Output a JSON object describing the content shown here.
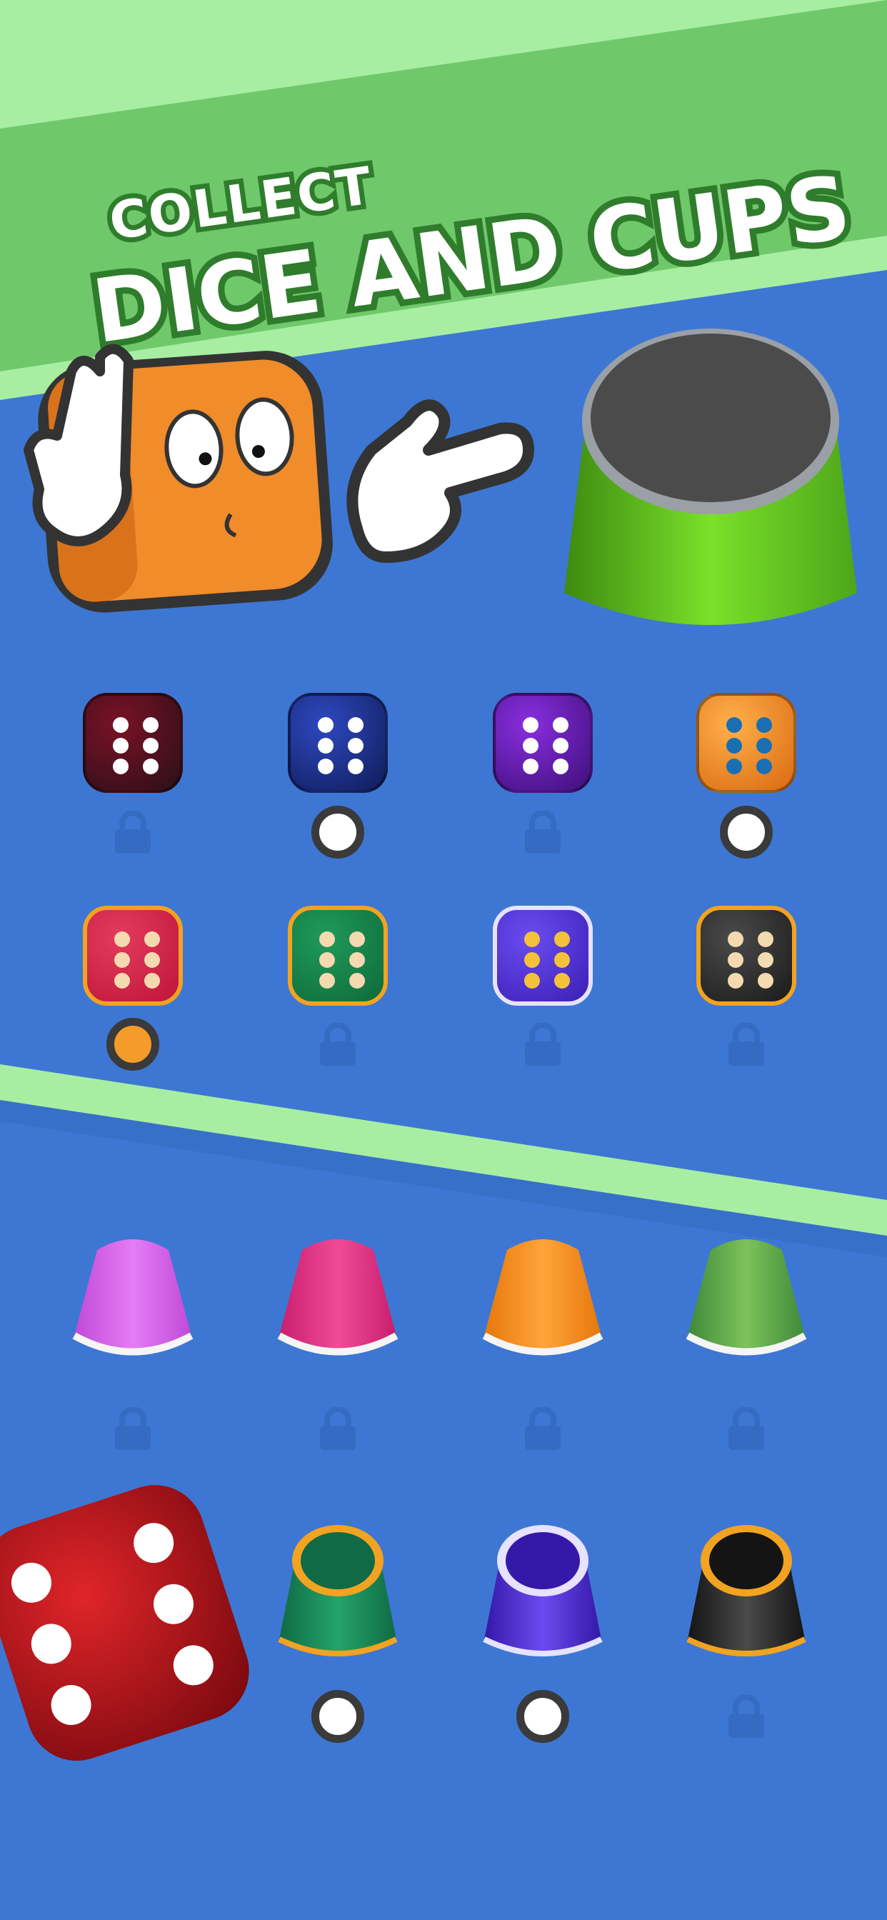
{
  "banner": {
    "line1": "COLLECT",
    "line2": "DICE AND CUPS"
  },
  "colors": {
    "background": "#3d77d3",
    "banner_green": "#6fc96a",
    "stripe_light_green": "#a7eea3",
    "title_text": "#ffffff",
    "title_outline": "#2f7d2c",
    "selected_radio": "#f39c2a"
  },
  "dice_row_1": [
    {
      "name": "dark-red-crystal-dice",
      "status": "locked",
      "pip_color": "#ffffff"
    },
    {
      "name": "dark-blue-crystal-dice",
      "status": "available",
      "pip_color": "#ffffff"
    },
    {
      "name": "purple-crystal-dice",
      "status": "locked",
      "pip_color": "#ffffff"
    },
    {
      "name": "orange-crystal-dice",
      "status": "available",
      "pip_color": "#1a6fb3"
    }
  ],
  "dice_row_2": [
    {
      "name": "red-gold-dice",
      "status": "selected",
      "pip_color": "#f5d9b0"
    },
    {
      "name": "green-gold-dice",
      "status": "locked",
      "pip_color": "#f5d9b0"
    },
    {
      "name": "purple-silver-dice",
      "status": "locked",
      "pip_color": "#f4c23a"
    },
    {
      "name": "carbon-gold-dice",
      "status": "locked",
      "pip_color": "#f5d9b0"
    }
  ],
  "cups_row_1": [
    {
      "name": "pink-patch-cup",
      "status": "locked"
    },
    {
      "name": "magenta-patch-cup",
      "status": "locked"
    },
    {
      "name": "orange-patch-cup",
      "status": "locked"
    },
    {
      "name": "green-stripe-cup",
      "status": "locked"
    }
  ],
  "cups_row_2": [
    {
      "name": "green-gold-cup",
      "status": "available"
    },
    {
      "name": "purple-silver-cup",
      "status": "available"
    },
    {
      "name": "carbon-gold-cup",
      "status": "locked"
    }
  ],
  "icons": [
    "lock-icon",
    "radio-icon",
    "pointing-hand-icon",
    "waving-hand-icon"
  ]
}
